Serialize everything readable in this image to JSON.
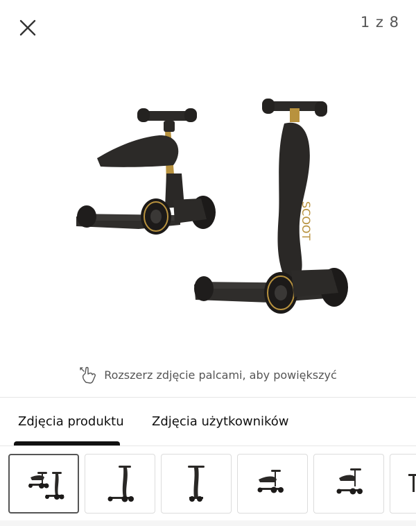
{
  "viewer": {
    "counter": "1 z 8",
    "hint_text": "Rozszerz zdjęcie palcami, aby powiększyć"
  },
  "tabs": [
    {
      "label": "Zdjęcia produktu",
      "active": true
    },
    {
      "label": "Zdjęcia użytkowników",
      "active": false
    }
  ],
  "thumbnails": {
    "count_visible": 6,
    "selected_index": 0
  },
  "colors": {
    "scooter_body": "#2a2826",
    "accent_gold": "#b8923e",
    "tab_active": "#111111"
  },
  "icons": [
    "close-icon",
    "pinch-zoom-icon"
  ]
}
